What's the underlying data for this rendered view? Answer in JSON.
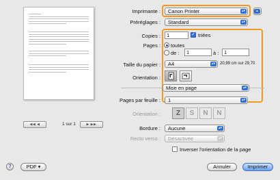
{
  "printer": {
    "label": "Imprimante :",
    "value": "Canon Printer"
  },
  "presets": {
    "label": "Préréglages :",
    "value": "Standard"
  },
  "copies": {
    "label": "Copies :",
    "value": "1",
    "collate_label": "triées"
  },
  "pages": {
    "label": "Pages :",
    "all_label": "toutes",
    "from_label": "de :",
    "from_value": "1",
    "to_label": "à :",
    "to_value": "1"
  },
  "paper_size": {
    "label": "Taille du papier :",
    "value": "A4",
    "dimensions": "20,99 cm sur 29,70"
  },
  "orientation": {
    "label": "Orientation :"
  },
  "section_popup": {
    "value": "Mise en page"
  },
  "layout": {
    "pages_per_sheet_label": "Pages par feuille :",
    "pages_per_sheet_value": "1",
    "orientation_label": "Orientation :",
    "icons": [
      "Z",
      "S",
      "N",
      "N"
    ],
    "border_label": "Bordure :",
    "border_value": "Aucune",
    "duplex_label": "Recto verso :",
    "duplex_value": "Désactivée",
    "reverse_label": "Inverser l'orientation de la page"
  },
  "preview": {
    "page_indicator": "1 sur 1",
    "prev_label": "◀◀ ◀",
    "next_label": "▶ ▶▶"
  },
  "footer": {
    "help_label": "?",
    "pdf_label": "PDF ▾",
    "cancel_label": "Annuler",
    "print_label": "Imprimer"
  },
  "colors": {
    "highlight": "#f39a1e",
    "accent": "#2f6fd6"
  }
}
